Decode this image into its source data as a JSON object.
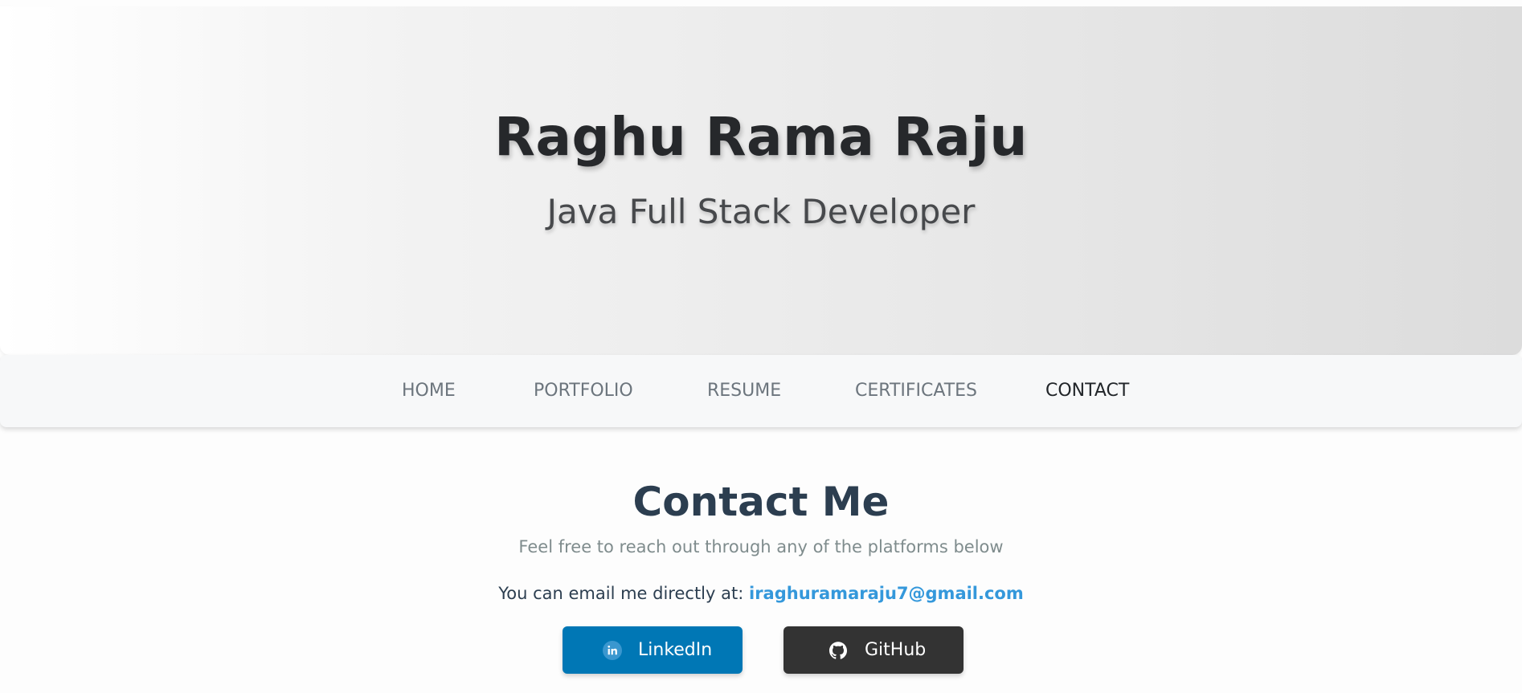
{
  "hero": {
    "name": "Raghu Rama Raju",
    "tagline": "Java Full Stack Developer"
  },
  "nav": {
    "items": [
      {
        "label": "HOME",
        "active": false
      },
      {
        "label": "PORTFOLIO",
        "active": false
      },
      {
        "label": "RESUME",
        "active": false
      },
      {
        "label": "CERTIFICATES",
        "active": false
      },
      {
        "label": "CONTACT",
        "active": true
      }
    ]
  },
  "contact": {
    "title": "Contact Me",
    "lead": "Feel free to reach out through any of the platforms below",
    "email_prefix": "You can email me directly at:",
    "email": "iraghuramaraju7@gmail.com",
    "buttons": [
      {
        "label": "LinkedIn",
        "icon": "linkedin-icon",
        "color": "#0077b5"
      },
      {
        "label": "GitHub",
        "icon": "github-icon",
        "color": "#333333"
      }
    ]
  },
  "colors": {
    "nav_active": "#212529",
    "nav_inactive": "#6c757d",
    "heading": "#2c3e50",
    "email_link": "#3498db"
  }
}
